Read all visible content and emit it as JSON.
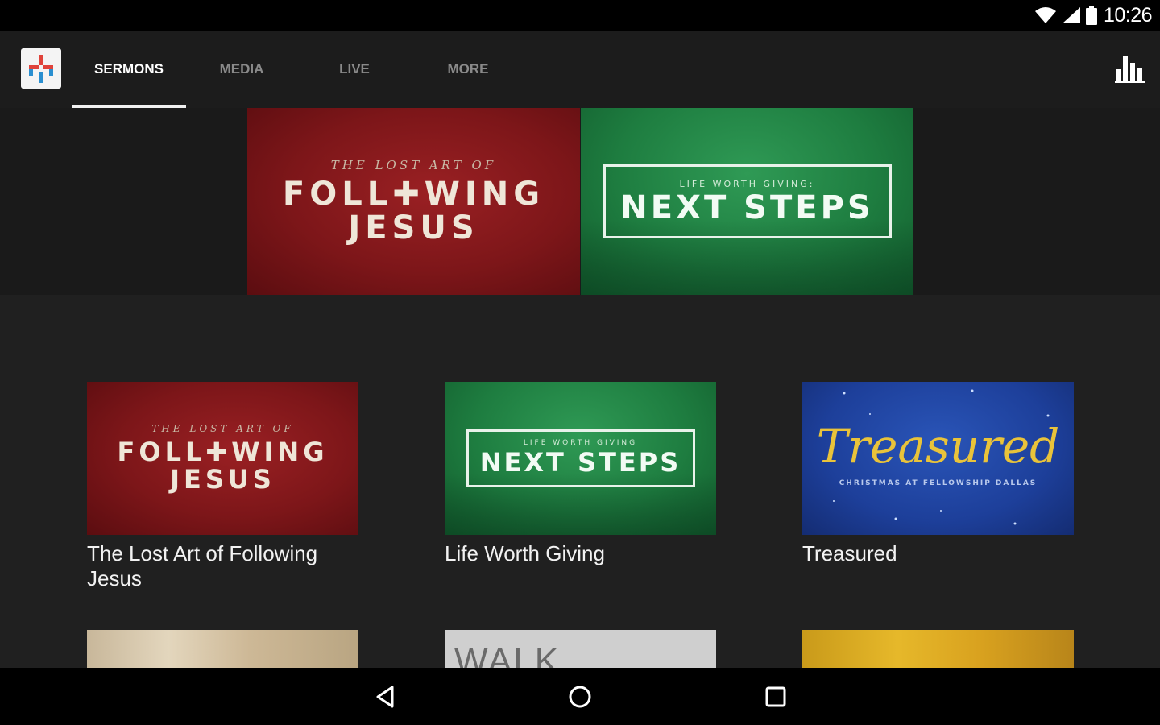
{
  "status_bar": {
    "time": "10:26",
    "icons": [
      "wifi-icon",
      "signal-icon",
      "battery-icon"
    ]
  },
  "app_bar": {
    "logo": "church-cross-logo",
    "tabs": [
      {
        "label": "SERMONS",
        "active": true
      },
      {
        "label": "MEDIA",
        "active": false
      },
      {
        "label": "LIVE",
        "active": false
      },
      {
        "label": "MORE",
        "active": false
      }
    ],
    "action_icon": "bar-chart-icon"
  },
  "hero": {
    "cards": [
      {
        "kicker": "THE LOST ART OF",
        "line1": "FOLL✚WING",
        "line2": "JESUS"
      },
      {
        "kicker": "LIFE WORTH GIVING:",
        "title": "NEXT STEPS"
      }
    ]
  },
  "series": [
    {
      "caption": "The Lost Art of Following Jesus",
      "art": {
        "kicker": "THE LOST ART OF",
        "line1": "FOLL✚WING",
        "line2": "JESUS"
      }
    },
    {
      "caption": "Life Worth Giving",
      "art": {
        "kicker": "LIFE WORTH GIVING",
        "title": "NEXT STEPS"
      }
    },
    {
      "caption": "Treasured",
      "art": {
        "script": "Treasured",
        "sub": "CHRISTMAS AT FELLOWSHIP DALLAS"
      }
    }
  ],
  "peek_row": [
    {
      "text": ""
    },
    {
      "text": "WALK"
    },
    {
      "text": ""
    }
  ],
  "nav_bar": {
    "icons": [
      "back-icon",
      "home-icon",
      "recents-icon"
    ]
  },
  "colors": {
    "background": "#202020",
    "app_bar": "#1c1c1c",
    "active_tab": "#ffffff",
    "inactive_tab": "#8a8a8a",
    "logo_red": "#e0433b",
    "logo_blue": "#2a8fd0"
  }
}
